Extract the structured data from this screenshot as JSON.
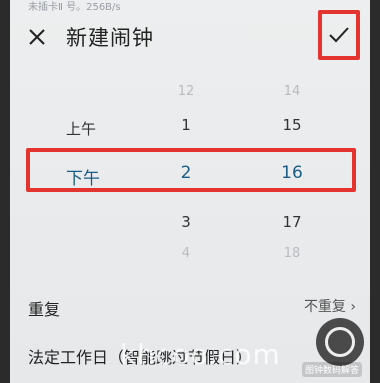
{
  "status_bar": {
    "text": "未插卡Ⅱ 号。256B/s"
  },
  "header": {
    "title": "新建闹钟",
    "close_icon": "close-icon",
    "confirm_icon": "check-icon"
  },
  "picker": {
    "ampm": {
      "am": "上午",
      "pm": "下午"
    },
    "hours": {
      "top_faint": "12",
      "above": "1",
      "selected": "2",
      "below": "3",
      "bottom_faint": "4"
    },
    "minutes": {
      "top_faint": "14",
      "above": "15",
      "selected": "16",
      "below": "17",
      "bottom_faint": "18"
    }
  },
  "settings": {
    "repeat": {
      "label": "重复",
      "value": "不重复"
    },
    "holiday": {
      "label": "法定工作日（智能跳过节假日）"
    }
  },
  "overlay": {
    "watermark": "khcoo.com",
    "credit": "图钟数码解答"
  },
  "colors": {
    "highlight": "#e3342f",
    "selected_text": "#1a5c86"
  }
}
